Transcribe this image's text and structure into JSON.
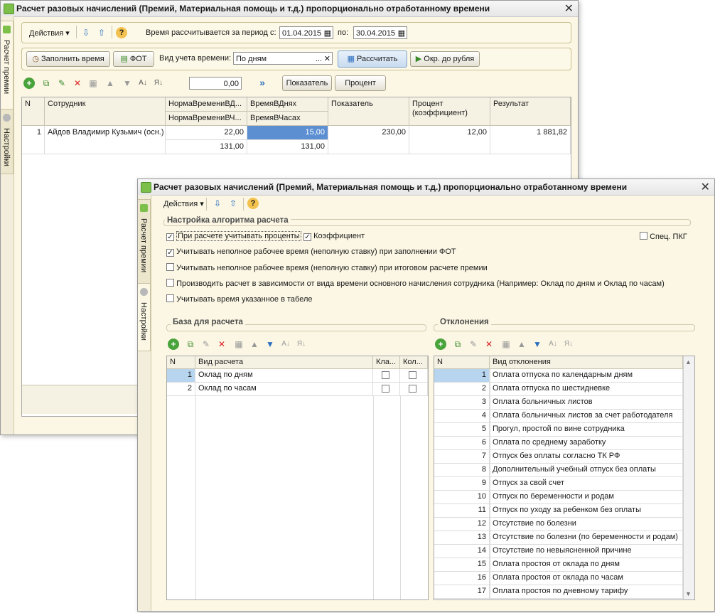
{
  "window1": {
    "title": "Расчет разовых начислений (Премий, Материальная помощь и т.д.) пропорционально отработанному времени",
    "side_tabs": [
      "Расчет премии",
      "Настройки"
    ],
    "toolbar": {
      "actions_label": "Действия ▾",
      "period_label": "Время рассчитывается за период с:",
      "date_from": "01.04.2015",
      "to_label": "по:",
      "date_to": "30.04.2015"
    },
    "toolbar2": {
      "fill_time_label": "Заполнить время",
      "fot_label": "ФОТ",
      "time_mode_label": "Вид учета времени:",
      "time_mode_value": "По дням",
      "calculate_label": "Рассчитать",
      "round_label": "Окр. до рубля"
    },
    "toolbar3": {
      "value": "0,00",
      "indicator_label": "Показатель",
      "percent_label": "Процент"
    },
    "table": {
      "headers": {
        "n": "N",
        "employee": "Сотрудник",
        "norm_days": "НормаВремениВД...",
        "norm_hours": "НормаВремениВЧ...",
        "time_days": "ВремяВДнях",
        "time_hours": "ВремяВЧасах",
        "indicator": "Показатель",
        "percent": "Процент\n(коэффициент)",
        "result": "Результат"
      },
      "rows": [
        {
          "n": "1",
          "employee": "Айдов Владимир Кузьмич (осн.)",
          "norm_days": "22,00",
          "norm_hours": "131,00",
          "time_days": "15,00",
          "time_hours": "131,00",
          "indicator": "230,00",
          "percent": "12,00",
          "result": "1 881,82"
        }
      ]
    }
  },
  "window2": {
    "title": "Расчет разовых начислений (Премий, Материальная помощь и т.д.) пропорционально отработанному времени",
    "side_tabs": [
      "Расчет премии",
      "Настройки"
    ],
    "actions_label": "Действия ▾",
    "algo_group_title": "Настройка алгоритма расчета",
    "options": [
      {
        "label": "При расчете учитывать проценты",
        "checked": true
      },
      {
        "label": "Коэффициент",
        "checked": true
      },
      {
        "label": "Спец. ПКГ",
        "checked": false
      },
      {
        "label": "Учитывать неполное рабочее время (неполную ставку) при заполнении ФОТ",
        "checked": true
      },
      {
        "label": "Учитывать неполное рабочее время (неполную ставку) при итоговом расчете премии",
        "checked": false
      },
      {
        "label": "Производить расчет в зависимости от вида времени основного начисления сотрудника (Например: Оклад по дням и Оклад по часам)",
        "checked": false
      },
      {
        "label": "Учитывать время указанное в табеле",
        "checked": false
      }
    ],
    "base_group_title": "База для расчета",
    "base_headers": {
      "n": "N",
      "kind": "Вид расчета",
      "kla": "Кла...",
      "kol": "Кол..."
    },
    "base_rows": [
      {
        "n": "1",
        "kind": "Оклад по дням"
      },
      {
        "n": "2",
        "kind": "Оклад по часам"
      }
    ],
    "dev_group_title": "Отклонения",
    "dev_headers": {
      "n": "N",
      "kind": "Вид отклонения"
    },
    "dev_rows": [
      {
        "n": "1",
        "kind": "Оплата отпуска по календарным дням"
      },
      {
        "n": "2",
        "kind": "Оплата отпуска по шестидневке"
      },
      {
        "n": "3",
        "kind": "Оплата больничных листов"
      },
      {
        "n": "4",
        "kind": "Оплата больничных листов за счет работодателя"
      },
      {
        "n": "5",
        "kind": "Прогул, простой по вине сотрудника"
      },
      {
        "n": "6",
        "kind": "Оплата по среднему заработку"
      },
      {
        "n": "7",
        "kind": "Отпуск без оплаты согласно ТК РФ"
      },
      {
        "n": "8",
        "kind": "Дополнительный учебный отпуск без оплаты"
      },
      {
        "n": "9",
        "kind": "Отпуск за свой счет"
      },
      {
        "n": "10",
        "kind": "Отпуск по беременности и родам"
      },
      {
        "n": "11",
        "kind": "Отпуск по уходу за ребенком без оплаты"
      },
      {
        "n": "12",
        "kind": "Отсутствие по болезни"
      },
      {
        "n": "13",
        "kind": "Отсутствие по болезни (по беременности и родам)"
      },
      {
        "n": "14",
        "kind": "Отсутствие по невыясненной причине"
      },
      {
        "n": "15",
        "kind": "Оплата простоя от оклада по дням"
      },
      {
        "n": "16",
        "kind": "Оплата простоя от оклада по часам"
      },
      {
        "n": "17",
        "kind": "Оплата простоя по дневному тарифу"
      }
    ]
  }
}
